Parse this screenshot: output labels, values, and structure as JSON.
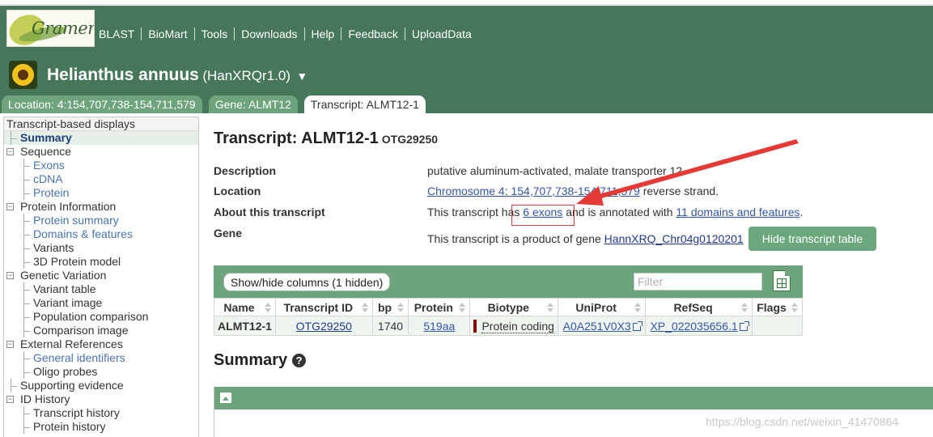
{
  "brand": {
    "logo_text": "Gramene"
  },
  "topnav": [
    "BLAST",
    "BioMart",
    "Tools",
    "Downloads",
    "Help",
    "Feedback",
    "UploadData"
  ],
  "species": {
    "name": "Helianthus annuus",
    "assembly": "(HanXRQr1.0)",
    "caret": "▼"
  },
  "tabs": [
    {
      "label": "Location: 4:154,707,738-154,711,579",
      "active": false
    },
    {
      "label": "Gene: ALMT12",
      "active": false
    },
    {
      "label": "Transcript: ALMT12-1",
      "active": true
    }
  ],
  "sidebar": {
    "heading": "Transcript-based displays",
    "items": [
      {
        "label": "Summary",
        "kind": "selected"
      },
      {
        "label": "Sequence",
        "kind": "group"
      },
      {
        "label": "Exons",
        "kind": "sub"
      },
      {
        "label": "cDNA",
        "kind": "sub"
      },
      {
        "label": "Protein",
        "kind": "sub"
      },
      {
        "label": "Protein Information",
        "kind": "group"
      },
      {
        "label": "Protein summary",
        "kind": "sub"
      },
      {
        "label": "Domains & features",
        "kind": "sub"
      },
      {
        "label": "Variants",
        "kind": "sub-plain"
      },
      {
        "label": "3D Protein model",
        "kind": "sub-plain"
      },
      {
        "label": "Genetic Variation",
        "kind": "group"
      },
      {
        "label": "Variant table",
        "kind": "sub-plain"
      },
      {
        "label": "Variant image",
        "kind": "sub-plain"
      },
      {
        "label": "Population comparison",
        "kind": "sub-plain"
      },
      {
        "label": "Comparison image",
        "kind": "sub-plain"
      },
      {
        "label": "External References",
        "kind": "group"
      },
      {
        "label": "General identifiers",
        "kind": "sub"
      },
      {
        "label": "Oligo probes",
        "kind": "sub-plain"
      },
      {
        "label": "Supporting evidence",
        "kind": "toplevel"
      },
      {
        "label": "ID History",
        "kind": "group"
      },
      {
        "label": "Transcript history",
        "kind": "sub-plain"
      },
      {
        "label": "Protein history",
        "kind": "sub-plain"
      }
    ]
  },
  "main": {
    "title": "Transcript: ALMT12-1",
    "title_id": "OTG29250",
    "description_label": "Description",
    "description_value": "putative aluminum-activated, malate transporter 12",
    "location_label": "Location",
    "location_link": "Chromosome 4: 154,707,738-154,711,579",
    "location_suffix": " reverse strand.",
    "about_label": "About this transcript",
    "about_prefix": "This transcript has ",
    "about_exons_link": "6 exons",
    "about_middle": " and is annotated with ",
    "about_domains_link": "11 domains and features",
    "about_suffix": ".",
    "gene_label": "Gene",
    "gene_prefix": "This transcript is a product of gene ",
    "gene_link": "HannXRQ_Chr04g0120201",
    "hide_button": "Hide transcript table"
  },
  "table": {
    "showhide_label": "Show/hide columns (1 hidden)",
    "filter_placeholder": "Filter",
    "headers": [
      "Name",
      "Transcript ID",
      "bp",
      "Protein",
      "Biotype",
      "UniProt",
      "RefSeq",
      "Flags"
    ],
    "row": {
      "name": "ALMT12-1",
      "transcript_id": "OTG29250",
      "bp": "1740",
      "protein": "519aa",
      "biotype": "Protein coding",
      "biotype_color": "#8b0000",
      "uniprot": "A0A251V0X3",
      "refseq": "XP_022035656.1",
      "flags": ""
    }
  },
  "summary": {
    "heading": "Summary",
    "help_glyph": "?"
  },
  "watermark": "https://blog.csdn.net/weixin_41470864",
  "colors": {
    "header_green": "#47775a",
    "tab_green": "#6ea47d",
    "button_green": "#6ba77c",
    "annotation_red": "#e53935"
  }
}
